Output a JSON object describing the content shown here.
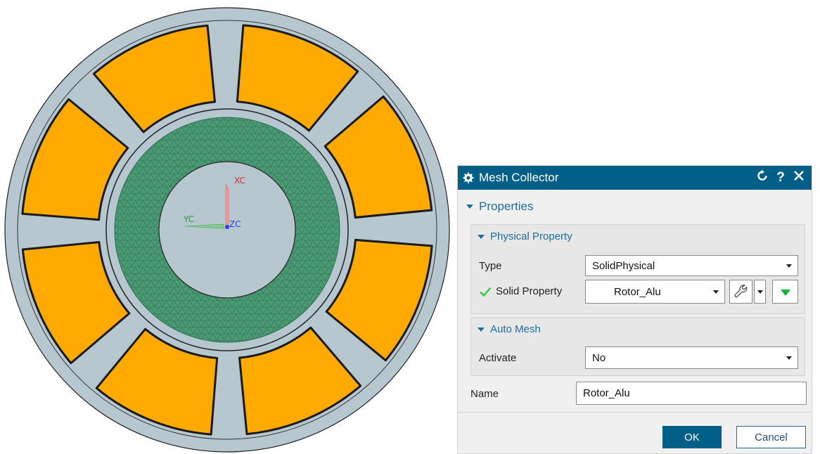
{
  "viewport": {
    "axes": {
      "x_label": "XC",
      "y_label": "YC",
      "z_label": "ZC"
    },
    "colors": {
      "magnets": "#ffaa00",
      "body": "#b6c7cf",
      "mesh": "#4a9a74",
      "background": "#ffffff"
    },
    "magnet_count": 8
  },
  "dialog": {
    "title": "Mesh Collector",
    "title_icon": "gear-icon",
    "controls": [
      "reset-icon",
      "help-icon",
      "close-icon"
    ],
    "properties_label": "Properties",
    "physical_property": {
      "label": "Physical Property",
      "type_label": "Type",
      "type_value": "SolidPhysical",
      "solid_property_label": "Solid Property",
      "solid_property_value": "Rotor_Alu"
    },
    "auto_mesh": {
      "label": "Auto Mesh",
      "activate_label": "Activate",
      "activate_value": "No"
    },
    "name_label": "Name",
    "name_value": "Rotor_Alu",
    "ok_label": "OK",
    "cancel_label": "Cancel",
    "colors": {
      "titlebar": "#005f87",
      "accent": "#1c6d99",
      "check": "#2ec83c"
    }
  }
}
